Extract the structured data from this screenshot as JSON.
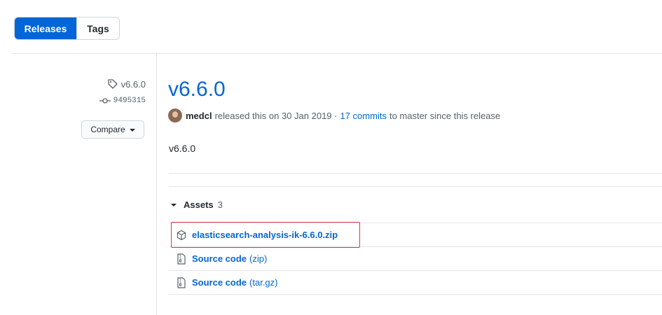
{
  "tabs": {
    "releases": "Releases",
    "tags": "Tags"
  },
  "sidebar": {
    "tag": "v6.6.0",
    "commit": "9495315",
    "compare": "Compare"
  },
  "release": {
    "title": "v6.6.0",
    "author": "medcl",
    "released_text": "released this on 30 Jan 2019 ·",
    "commits_link": "17 commits",
    "since_text": "to master since this release",
    "body": "v6.6.0"
  },
  "assets": {
    "label": "Assets",
    "count": "3",
    "items": [
      {
        "name": "elasticsearch-analysis-ik-6.6.0.zip",
        "suffix": "",
        "icon": "package-icon"
      },
      {
        "name": "Source code",
        "suffix": "(zip)",
        "icon": "file-zip-icon"
      },
      {
        "name": "Source code",
        "suffix": "(tar.gz)",
        "icon": "file-zip-icon"
      }
    ]
  },
  "colors": {
    "accent": "#0366d6",
    "highlight": "#d73a49"
  }
}
